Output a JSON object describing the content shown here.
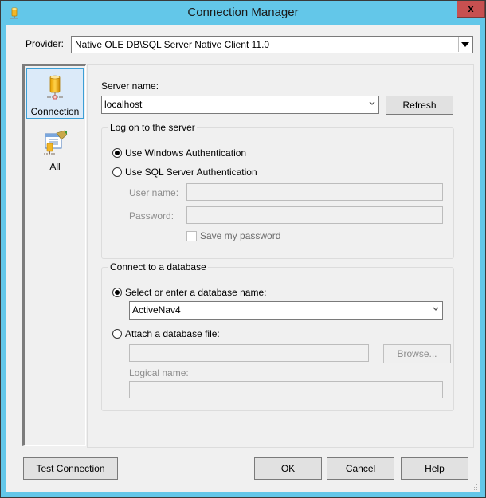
{
  "window": {
    "title": "Connection Manager",
    "close_label": "x"
  },
  "provider": {
    "label": "Provider:",
    "value": "Native OLE DB\\SQL Server Native Client 11.0"
  },
  "nav": {
    "items": [
      {
        "label": "Connection",
        "selected": true,
        "icon": "database-connection-icon"
      },
      {
        "label": "All",
        "selected": false,
        "icon": "properties-all-icon"
      }
    ]
  },
  "server": {
    "label": "Server name:",
    "value": "localhost",
    "refresh_label": "Refresh"
  },
  "logon": {
    "group_title": "Log on to the server",
    "windows_auth_label": "Use Windows Authentication",
    "sql_auth_label": "Use SQL Server Authentication",
    "selected": "windows",
    "username_label": "User name:",
    "username_value": "",
    "password_label": "Password:",
    "password_value": "",
    "save_password_label": "Save my password",
    "save_password_checked": false
  },
  "database": {
    "group_title": "Connect to a database",
    "select_label": "Select or enter a database name:",
    "select_value": "ActiveNav4",
    "attach_label": "Attach a database file:",
    "attach_value": "",
    "browse_label": "Browse...",
    "logical_name_label": "Logical name:",
    "logical_name_value": "",
    "selected": "select"
  },
  "footer": {
    "test_connection_label": "Test Connection",
    "ok_label": "OK",
    "cancel_label": "Cancel",
    "help_label": "Help"
  },
  "colors": {
    "titlebar": "#63c7e9",
    "close_button": "#c75050",
    "selection": "#dbeaf9",
    "selection_border": "#3c9fd6"
  }
}
